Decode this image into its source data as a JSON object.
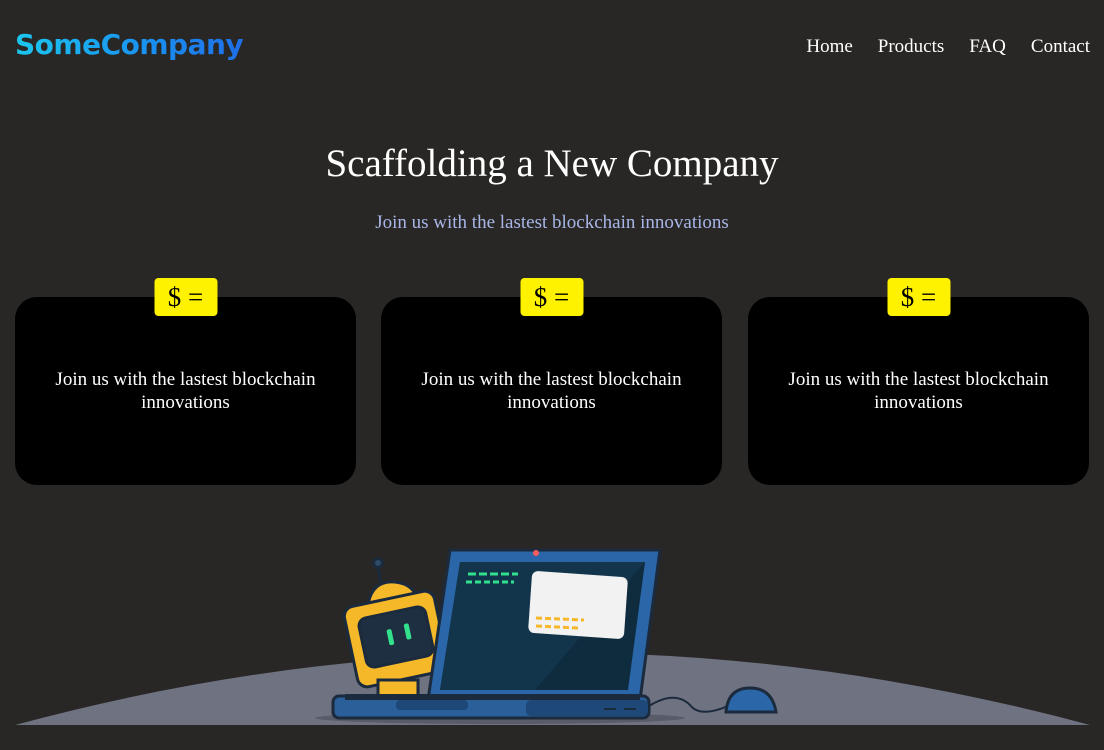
{
  "brand": {
    "logo": "SomeCompany"
  },
  "nav": {
    "items": [
      {
        "label": "Home"
      },
      {
        "label": "Products"
      },
      {
        "label": "FAQ"
      },
      {
        "label": "Contact"
      }
    ]
  },
  "hero": {
    "title": "Scaffolding a New Company",
    "subtitle": "Join us with the lastest blockchain innovations"
  },
  "cards": [
    {
      "icon": "$ =",
      "text": "Join us with the lastest blockchain innovations"
    },
    {
      "icon": "$ =",
      "text": "Join us with the lastest blockchain innovations"
    },
    {
      "icon": "$ =",
      "text": "Join us with the lastest blockchain innovations"
    }
  ],
  "illustration": {
    "name": "robot-laptop-illustration"
  },
  "colors": {
    "background": "#282725",
    "card": "#000000",
    "badge": "#fff200",
    "subtitle": "#a8b6e8",
    "logo_start": "#1bc6ee",
    "logo_end": "#1f6fe8"
  }
}
